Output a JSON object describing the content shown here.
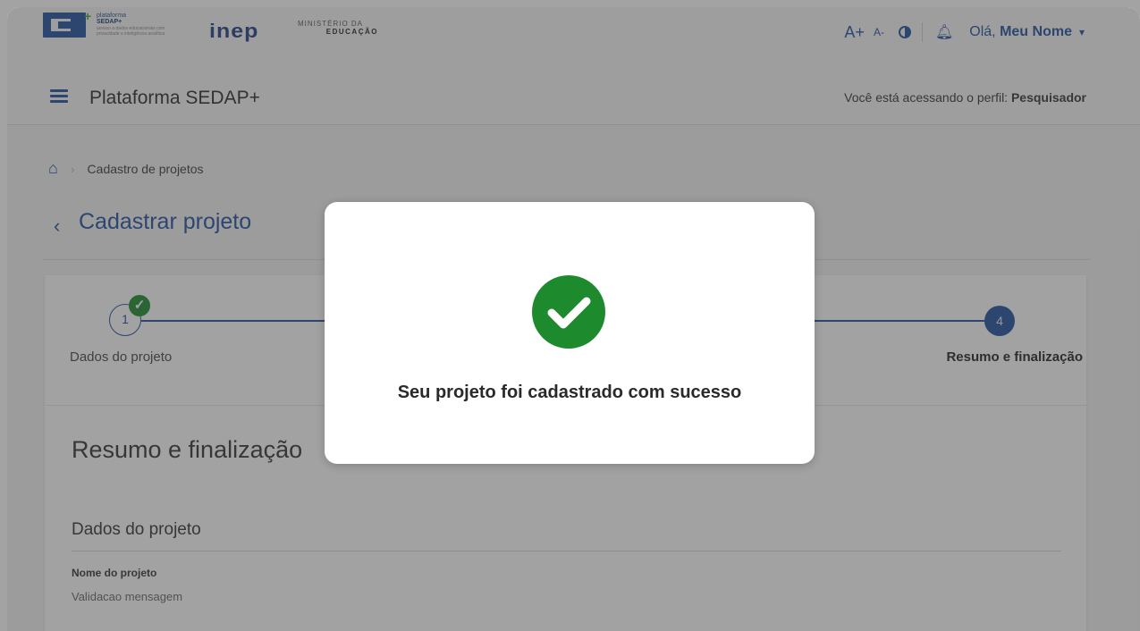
{
  "header": {
    "logo_sedap": {
      "line1": "plataforma",
      "line2": "SEDAP+",
      "line3": "acesso a dados educacionais com privacidade e inteligência analítica"
    },
    "logo_inep": "inep",
    "ministry": {
      "line1": "MINISTÉRIO DA",
      "line2": "EDUCAÇÃO"
    },
    "font_increase": "A+",
    "font_decrease": "A-",
    "greeting_prefix": "Olá,",
    "user_name": "Meu Nome"
  },
  "navbar": {
    "title": "Plataforma SEDAP+",
    "profile_prefix": "Você está acessando o perfil:",
    "profile_name": "Pesquisador"
  },
  "breadcrumb": {
    "current": "Cadastro de projetos"
  },
  "page": {
    "title": "Cadastrar projeto"
  },
  "stepper": {
    "steps": [
      {
        "number": "1",
        "label": "Dados do projeto",
        "completed": true
      },
      {
        "number": "4",
        "label": "Resumo e finalização",
        "active": true
      }
    ]
  },
  "summary": {
    "title": "Resumo e finalização",
    "section_title": "Dados do projeto",
    "field_label": "Nome do projeto",
    "field_value": "Validacao mensagem"
  },
  "modal": {
    "message": "Seu projeto foi cadastrado com sucesso",
    "icon": "check-circle-icon"
  },
  "colors": {
    "primary": "#1f4fa0",
    "success": "#1d8a2d",
    "overlay": "rgba(60,60,60,0.48)"
  }
}
